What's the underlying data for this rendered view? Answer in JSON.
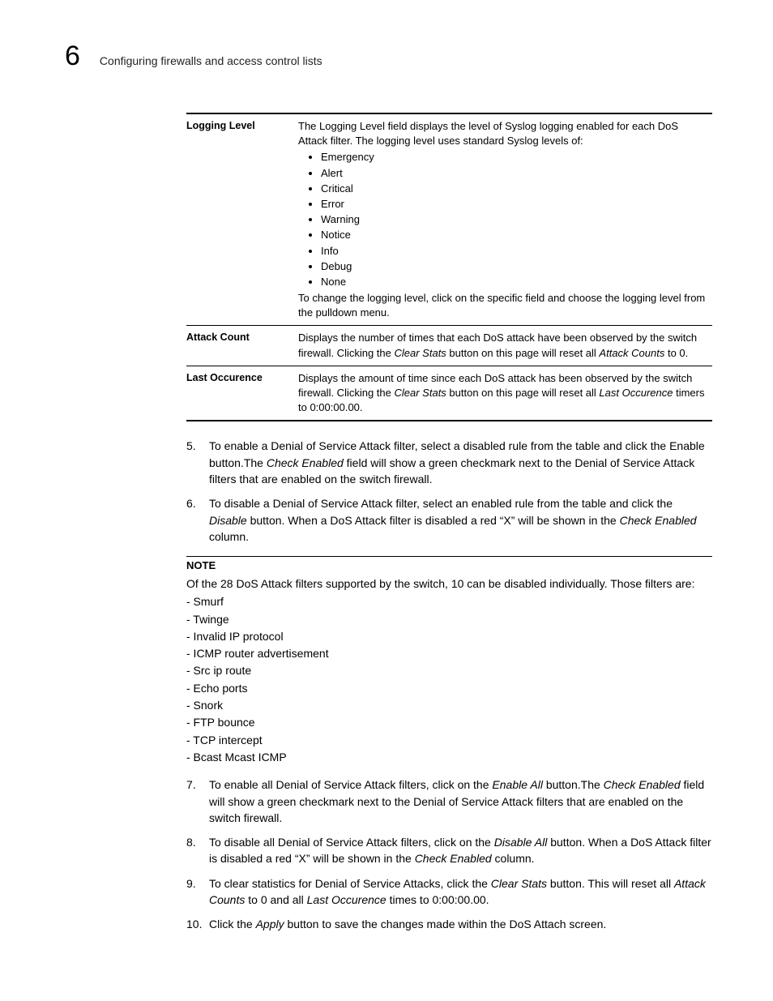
{
  "header": {
    "chapter_number": "6",
    "title": "Configuring firewalls and access control lists"
  },
  "table": {
    "rows": [
      {
        "label": "Logging Level",
        "intro": "The Logging Level field displays the level of Syslog logging enabled for each DoS Attack filter. The logging level uses standard Syslog levels of:",
        "bullets": [
          "Emergency",
          "Alert",
          "Critical",
          "Error",
          "Warning",
          "Notice",
          "Info",
          "Debug",
          "None"
        ],
        "outro": "To change the logging level, click on the specific field and choose the logging level from the pulldown menu."
      },
      {
        "label": "Attack Count",
        "text_parts": [
          "Displays the number of times that each DoS attack have been observed by the switch firewall. Clicking the ",
          "Clear Stats",
          " button on this page will reset all ",
          "Attack Counts",
          " to 0."
        ]
      },
      {
        "label": "Last Occurence",
        "text_parts": [
          "Displays the amount of time since each DoS attack has been observed by the switch firewall. Clicking the ",
          "Clear Stats",
          " button on this page will reset all ",
          "Last Occurence",
          " timers to 0:00:00.00."
        ]
      }
    ]
  },
  "steps_a": [
    {
      "num": "5.",
      "parts": [
        "To enable a Denial of Service Attack filter, select a disabled rule from the table and click the Enable button.The ",
        "Check Enabled",
        " field will show a green checkmark next to the Denial of Service Attack filters that are enabled on the switch firewall."
      ]
    },
    {
      "num": "6.",
      "parts": [
        "To disable a Denial of Service Attack filter, select an enabled rule from the table and click the ",
        "Disable",
        " button. When a DoS Attack filter is disabled a red “X” will be shown in the ",
        "Check Enabled",
        " column."
      ]
    }
  ],
  "note": {
    "label": "NOTE",
    "intro": "Of the 28 DoS Attack filters supported by the switch, 10 can be disabled individually. Those filters are:",
    "items": [
      "- Smurf",
      "- Twinge",
      "- Invalid IP protocol",
      "- ICMP router advertisement",
      "- Src ip route",
      "- Echo ports",
      "- Snork",
      "- FTP bounce",
      "- TCP intercept",
      "- Bcast Mcast ICMP"
    ]
  },
  "steps_b": [
    {
      "num": "7.",
      "parts": [
        "To enable all Denial of Service Attack filters, click on the ",
        "Enable All",
        " button.The ",
        "Check Enabled",
        " field will show a green checkmark next to the Denial of Service Attack filters that are enabled on the switch firewall."
      ]
    },
    {
      "num": "8.",
      "parts": [
        "To disable all Denial of Service Attack filters, click on the ",
        "Disable All",
        " button. When a DoS Attack filter is disabled a red “X” will be shown in the ",
        "Check Enabled",
        " column."
      ]
    },
    {
      "num": "9.",
      "parts": [
        "To clear statistics for Denial of Service Attacks, click the ",
        "Clear Stats",
        " button. This will reset all ",
        "Attack Counts",
        " to 0 and all ",
        "Last Occurence",
        " times to 0:00:00.00."
      ]
    },
    {
      "num": "10.",
      "parts": [
        "Click the ",
        "Apply",
        " button to save the changes made within the DoS Attach screen."
      ]
    }
  ]
}
